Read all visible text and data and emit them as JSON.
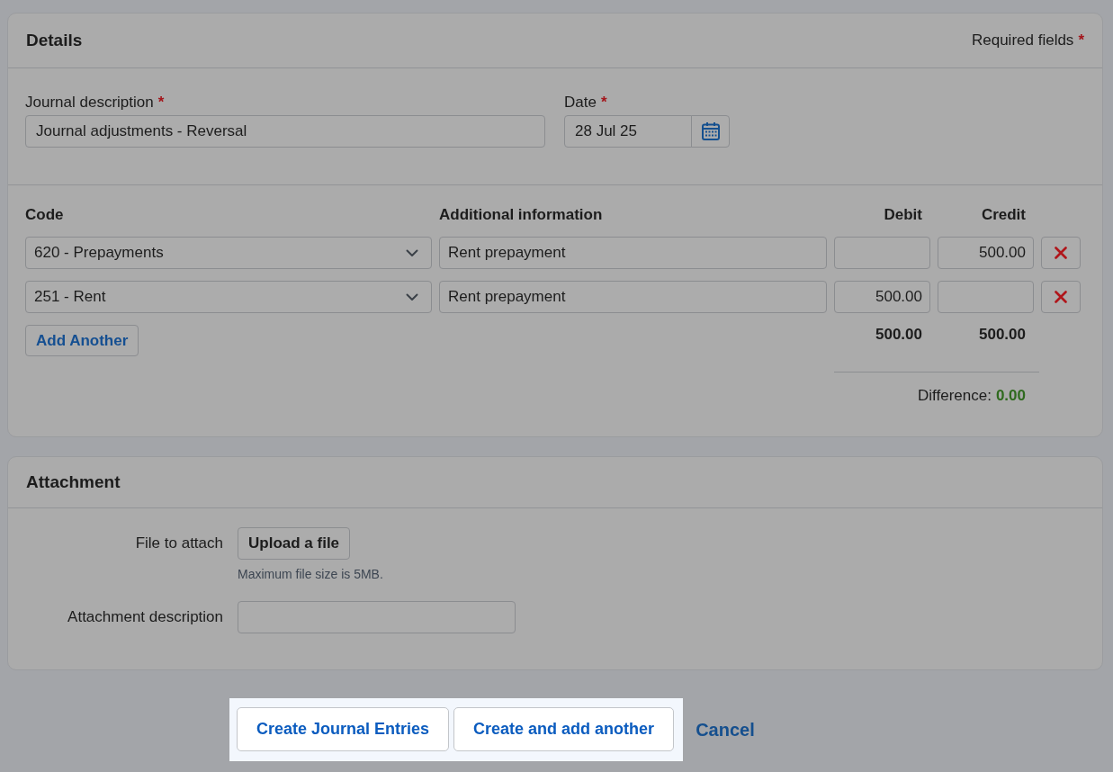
{
  "details": {
    "title": "Details",
    "required_note": {
      "text": "Required fields",
      "mark": "*"
    },
    "fields": [
      {
        "kind": "text",
        "label": "Journal description",
        "required_mark": "*",
        "value": "Journal adjustments - Reversal"
      },
      {
        "kind": "date",
        "label": "Date",
        "required_mark": "*",
        "value": "28 Jul 25"
      }
    ],
    "lines": {
      "columns": [
        "Code",
        "Additional information",
        "Debit",
        "Credit"
      ],
      "rows": [
        {
          "code": "620 - Prepayments",
          "info": "Rent prepayment",
          "credit": "500.00"
        },
        {
          "code": "251 - Rent",
          "info": "Rent prepayment",
          "debit": "500.00"
        }
      ],
      "add_button": "Add Another",
      "totals": {
        "debit": "500.00",
        "credit": "500.00"
      },
      "difference": {
        "label": "Difference:",
        "value": "0.00",
        "balanced": true
      }
    }
  },
  "attachment": {
    "title": "Attachment",
    "file_label": "File to attach",
    "upload_button": "Upload a file",
    "hint": "Maximum file size is 5MB.",
    "description_label": "Attachment description"
  },
  "actions": {
    "highlighted": true,
    "buttons": [
      "Create Journal Entries",
      "Create and add another"
    ],
    "cancel": "Cancel"
  }
}
